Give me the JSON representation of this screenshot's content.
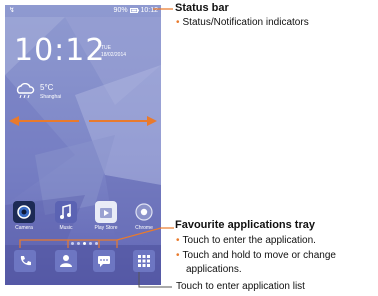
{
  "status_bar": {
    "left_icon": "↯",
    "battery": "90%",
    "time": "10:12"
  },
  "clock": {
    "time": "10:12",
    "day": "TUE",
    "date": "18/02/2014"
  },
  "weather": {
    "temp": "5°C",
    "city": "Shanghai",
    "icon": "rain-cloud-icon"
  },
  "apps": [
    {
      "label": "Camera",
      "icon": "camera-icon"
    },
    {
      "label": "Music",
      "icon": "music-icon"
    },
    {
      "label": "Play Store",
      "icon": "play-store-icon"
    },
    {
      "label": "Chrome",
      "icon": "chrome-icon"
    }
  ],
  "tray": [
    {
      "icon": "phone-icon"
    },
    {
      "icon": "contacts-icon"
    },
    {
      "icon": "messages-icon"
    },
    {
      "icon": "app-list-icon"
    }
  ],
  "annotations": {
    "status_bar_title": "Status bar",
    "status_bar_bullet": "Status/Notification indicators",
    "tray_title": "Favourite applications tray",
    "tray_bullet_1": "Touch to enter the application.",
    "tray_bullet_2a": "Touch and hold to move or change",
    "tray_bullet_2b": "applications.",
    "app_list": "Touch to enter application list",
    "bullet_glyph": "•"
  },
  "colors": {
    "accent": "#e97a2c",
    "wallpaper": "#7d86c7"
  }
}
